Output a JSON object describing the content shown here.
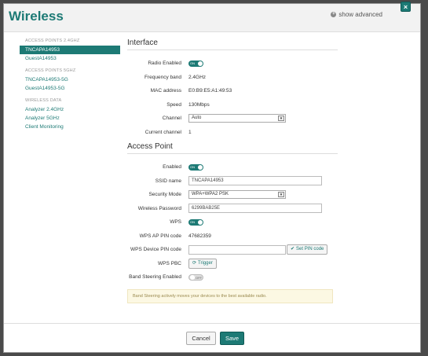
{
  "header": {
    "title": "Wireless",
    "show_advanced": "show advanced",
    "close": "×"
  },
  "sidebar": {
    "group1": "ACCESS POINTS 2.4GHZ",
    "items1": [
      "TNCAPA14953",
      "GuestA14953"
    ],
    "group2": "ACCESS POINTS 5GHZ",
    "items2": [
      "TNCAPA14953-5G",
      "GuestA14953-5G"
    ],
    "group3": "WIRELESS DATA",
    "items3": [
      "Analyzer 2.4GHz",
      "Analyzer 5GHz",
      "Client Monitoring"
    ]
  },
  "interface": {
    "title": "Interface",
    "radio_label": "Radio Enabled",
    "radio_toggle": "ON",
    "freq_label": "Frequency band",
    "freq_value": "2.4GHz",
    "mac_label": "MAC address",
    "mac_value": "E0:B9:E5:A1:49:53",
    "speed_label": "Speed",
    "speed_value": "130Mbps",
    "channel_label": "Channel",
    "channel_value": "Auto",
    "current_label": "Current channel",
    "current_value": "1"
  },
  "access_point": {
    "title": "Access Point",
    "enabled_label": "Enabled",
    "enabled_toggle": "ON",
    "ssid_label": "SSID name",
    "ssid_value": "TNCAPA14953",
    "security_label": "Security Mode",
    "security_value": "WPA+WPA2 PSK",
    "password_label": "Wireless Password",
    "password_value": "6299BAB25E",
    "wps_label": "WPS",
    "wps_toggle": "ON",
    "pin_label": "WPS AP PIN code",
    "pin_value": "47682359",
    "device_pin_label": "WPS Device PIN code",
    "device_pin_value": "",
    "set_pin_button": "Set PIN code",
    "pbc_label": "WPS PBC",
    "trigger_button": "Trigger",
    "band_label": "Band Steering Enabled",
    "band_toggle": "OFF",
    "note": "Band Steering actively moves your devices to the best available radio."
  },
  "footer": {
    "cancel": "Cancel",
    "save": "Save"
  }
}
